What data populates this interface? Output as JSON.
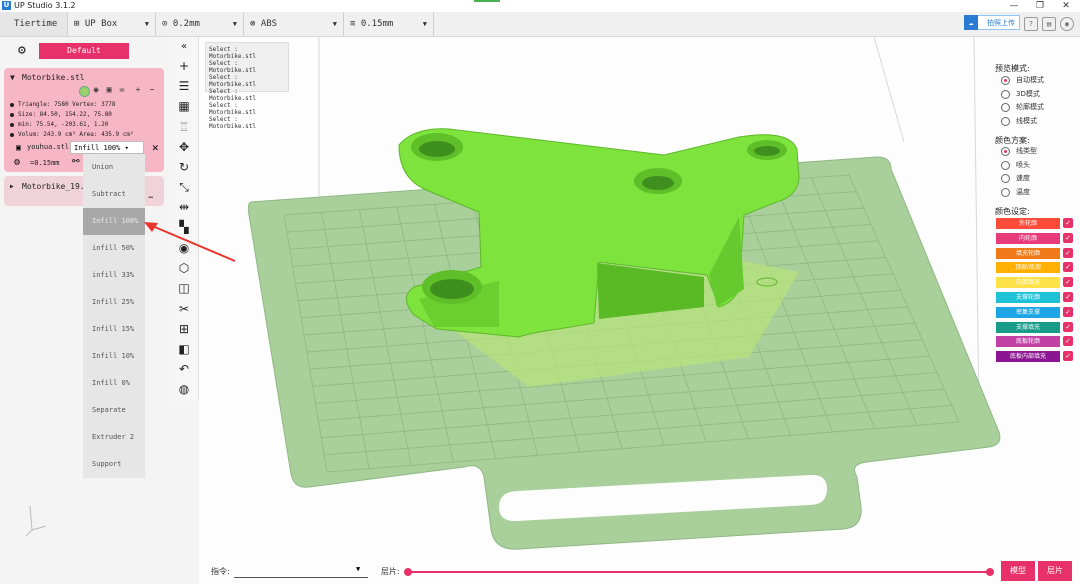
{
  "app": {
    "title": "UP Studio 3.1.2",
    "logo_letter": "U"
  },
  "window": {
    "minimize": "—",
    "maximize": "❐",
    "close": "✕"
  },
  "toolbar": {
    "items": [
      {
        "label": "Tiertime"
      },
      {
        "label": "UP Box",
        "icon": "printer-icon"
      },
      {
        "label": "0.2mm",
        "icon": "nozzle-icon"
      },
      {
        "label": "ABS",
        "icon": "material-icon"
      },
      {
        "label": "0.15mm",
        "icon": "layer-icon"
      }
    ],
    "upload_label": "拍照上传"
  },
  "left": {
    "profile_button": "Default",
    "model1": {
      "name": "Motorbike.stl",
      "triangle": "Triangle: 7580   Vertex: 3778",
      "size": "Size: 84.50, 154.22, 75.80",
      "min": "min: 75.54, -203.61, 1.20",
      "volume": "Volum: 243.9 cm³   Area: 435.9 cm²"
    },
    "sub_model": {
      "name": "youhua.stl",
      "infill_value": "Infill 100%",
      "layer": "=0.15mm"
    },
    "model2": {
      "name": "Motorbike_19."
    }
  },
  "menu": {
    "items": [
      "Union",
      "Subtract",
      "Infill 100%",
      "infill 50%",
      "infill 33%",
      "Infill 25%",
      "Infill 15%",
      "Infill 10%",
      "Infill 0%",
      "Separate",
      "Extruder 2",
      "Support"
    ],
    "active_index": 2
  },
  "log": {
    "lines": [
      "Select : Motorbike.stl",
      "Select : Motorbike.stl",
      "Select : Motorbike.stl",
      "Select : Motorbike.stl",
      "Select : Motorbike.stl",
      "Select : Motorbike.stl"
    ]
  },
  "right": {
    "preview_mode_title": "预览模式:",
    "preview_modes": [
      "自动模式",
      "3D模式",
      "轮廓模式",
      "线模式"
    ],
    "preview_selected": 0,
    "color_scheme_title": "颜色方案:",
    "color_schemes": [
      "线类型",
      "喷头",
      "速度",
      "温度"
    ],
    "color_selected": 0,
    "color_settings_title": "颜色设定:",
    "color_settings": [
      {
        "label": "外轮廓",
        "color": "#ff4b3a"
      },
      {
        "label": "内轮廓",
        "color": "#e83b7b"
      },
      {
        "label": "填充轮廓",
        "color": "#f07a1a"
      },
      {
        "label": "顶部/底部",
        "color": "#ffb000"
      },
      {
        "label": "内部填充",
        "color": "#ffe24a"
      },
      {
        "label": "支撑轮廓",
        "color": "#1ec2d6"
      },
      {
        "label": "密集支撑",
        "color": "#1ea5e6"
      },
      {
        "label": "支撑填充",
        "color": "#189c8a"
      },
      {
        "label": "底板轮廓",
        "color": "#c23fa4"
      },
      {
        "label": "底板内部填充",
        "color": "#8b1592"
      }
    ]
  },
  "bottom": {
    "cmd_label": "指令:",
    "layer_label": "层片:",
    "model_button": "模型",
    "layer_button": "层片"
  },
  "colors": {
    "accent": "#e8316a",
    "model": "#7ee33c",
    "platform": "#a9cf9a"
  }
}
